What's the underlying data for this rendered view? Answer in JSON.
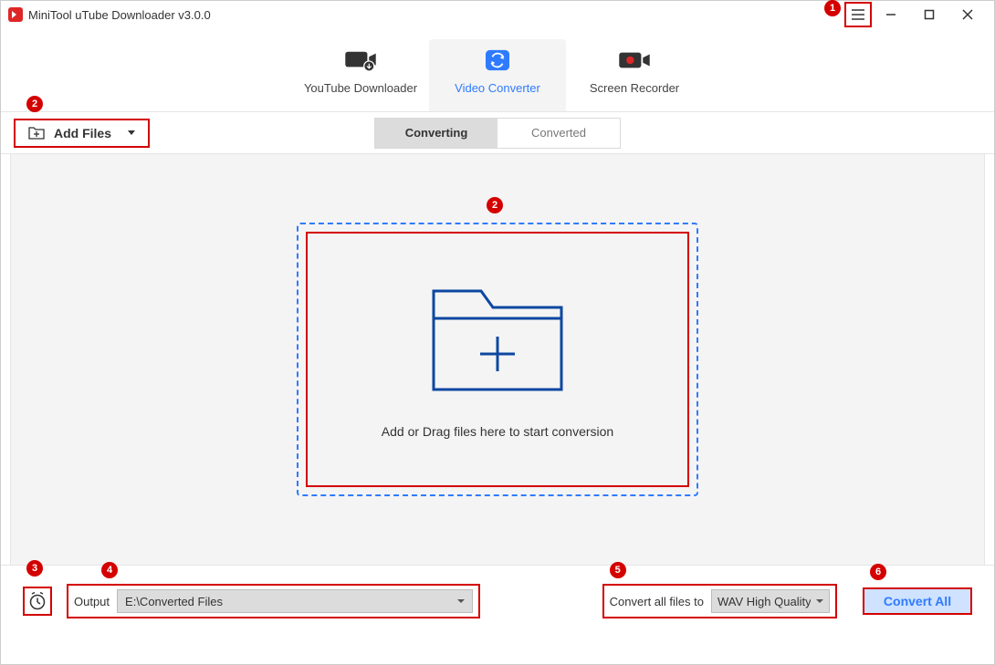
{
  "title": "MiniTool uTube Downloader v3.0.0",
  "main_tabs": {
    "downloader": "YouTube Downloader",
    "converter": "Video Converter",
    "recorder": "Screen Recorder"
  },
  "toolbar": {
    "add_files": "Add Files",
    "sub_converting": "Converting",
    "sub_converted": "Converted"
  },
  "dropzone": {
    "text": "Add or Drag files here to start conversion"
  },
  "bottom": {
    "output_label": "Output",
    "output_path": "E:\\Converted Files",
    "convert_label": "Convert all files to",
    "format": "WAV High Quality",
    "convert_btn": "Convert All"
  },
  "badges": {
    "b1": "1",
    "b2": "2",
    "b2b": "2",
    "b3": "3",
    "b4": "4",
    "b5": "5",
    "b6": "6"
  }
}
